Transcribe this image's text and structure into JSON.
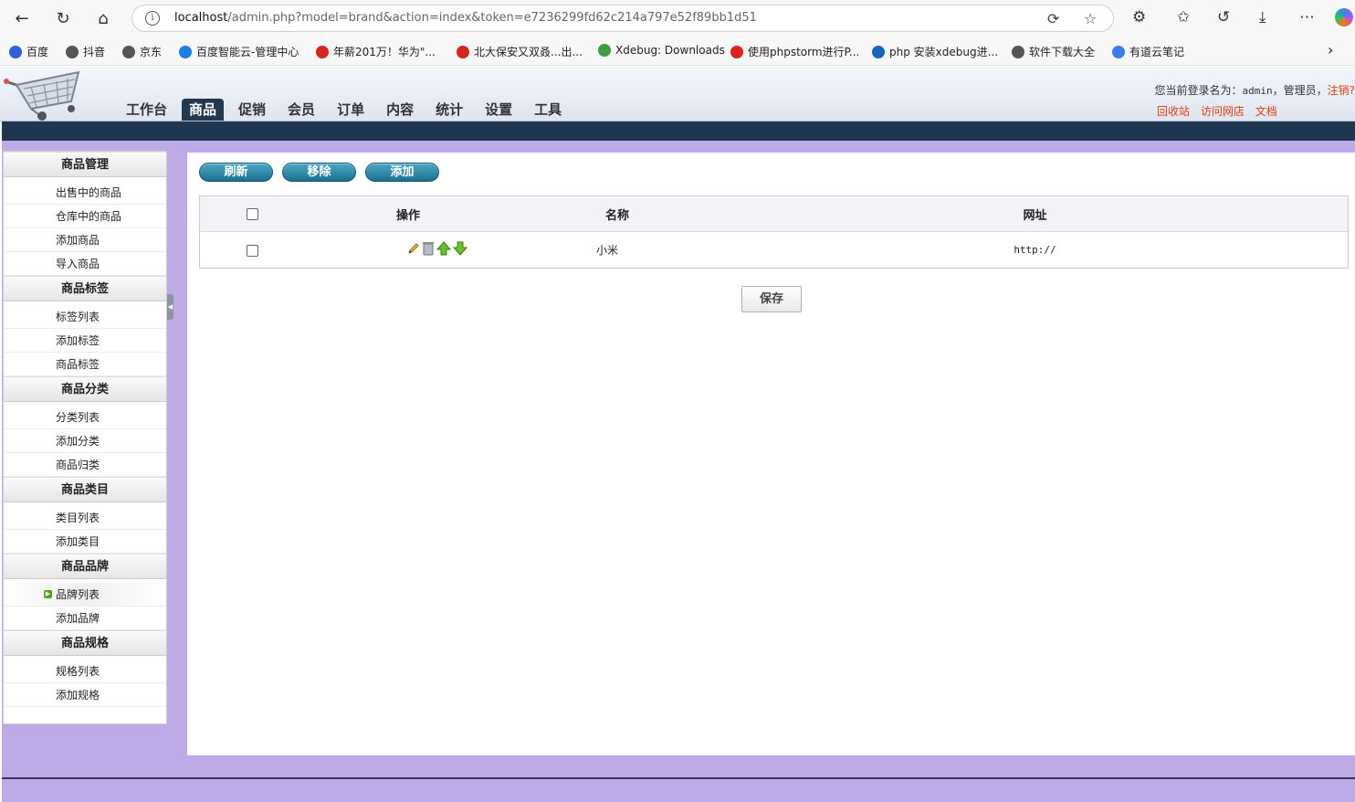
{
  "browser": {
    "url_host": "localhost",
    "url_rest": "/admin.php?model=brand&action=index&token=e7236299fd62c214a797e52f89bb1d51",
    "bookmarks": [
      {
        "label": "百度",
        "color": "#2e5ed9"
      },
      {
        "label": "抖音",
        "color": "#555555"
      },
      {
        "label": "京东",
        "color": "#555555"
      },
      {
        "label": "百度智能云-管理中心",
        "color": "#1f7ee6"
      },
      {
        "label": "年薪201万！华为\"...",
        "color": "#d6261c"
      },
      {
        "label": "北大保安又双叒...出...",
        "color": "#d6261c"
      },
      {
        "label": "Xdebug: Downloads",
        "color": "#3b9d3b"
      },
      {
        "label": "使用phpstorm进行P...",
        "color": "#e02020"
      },
      {
        "label": "php 安装xdebug进...",
        "color": "#1565c0"
      },
      {
        "label": "软件下载大全",
        "color": "#555555"
      },
      {
        "label": "有道云笔记",
        "color": "#3d7cf0"
      }
    ]
  },
  "header": {
    "nav": [
      "工作台",
      "商品",
      "促销",
      "会员",
      "订单",
      "内容",
      "统计",
      "设置",
      "工具"
    ],
    "active_nav": "商品",
    "login_prefix": "您当前登录名为：",
    "username": "admin",
    "role": "，管理员，",
    "logout": "注销?",
    "links": [
      "回收站",
      "访问网店",
      "文档"
    ]
  },
  "sidebar": {
    "groups": [
      {
        "title": "商品管理",
        "items": [
          "出售中的商品",
          "仓库中的商品",
          "添加商品",
          "导入商品"
        ]
      },
      {
        "title": "商品标签",
        "items": [
          "标签列表",
          "添加标签",
          "商品标签"
        ]
      },
      {
        "title": "商品分类",
        "items": [
          "分类列表",
          "添加分类",
          "商品归类"
        ]
      },
      {
        "title": "商品类目",
        "items": [
          "类目列表",
          "添加类目"
        ]
      },
      {
        "title": "商品品牌",
        "items": [
          "品牌列表",
          "添加品牌"
        ]
      },
      {
        "title": "商品规格",
        "items": [
          "规格列表",
          "添加规格"
        ]
      }
    ],
    "current_item": "品牌列表"
  },
  "toolbar": {
    "refresh": "刷新",
    "remove": "移除",
    "add": "添加"
  },
  "table": {
    "headers": {
      "operation": "操作",
      "name": "名称",
      "url": "网址"
    },
    "rows": [
      {
        "name": "小米",
        "url": "http://"
      }
    ]
  },
  "save_label": "保存",
  "colors": {
    "nav_dark": "#22384f",
    "accent_red": "#e03c0c",
    "purple_bg": "#bdaae6",
    "pill_blue": "#1b6f8f"
  }
}
